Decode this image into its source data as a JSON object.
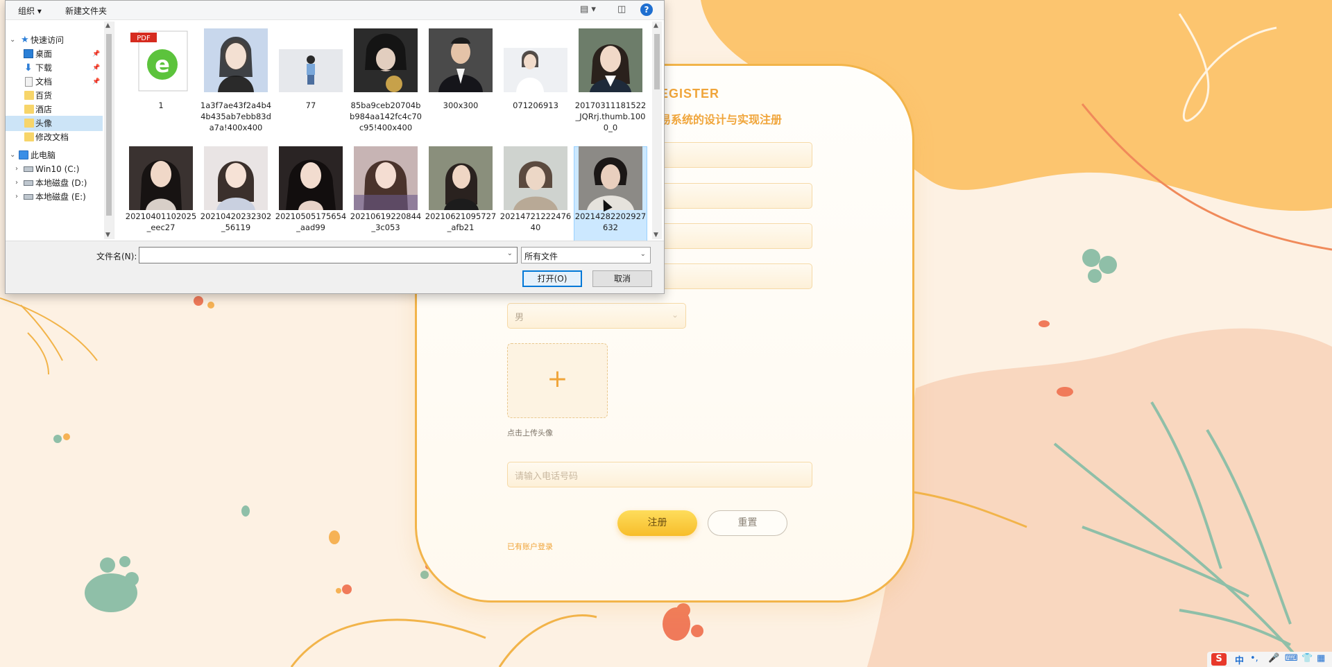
{
  "background": {
    "colors": {
      "base": "#fdf1e3",
      "orange_blob": "#fbc36c",
      "peach_blob": "#f6c6a8",
      "leaf": "#8fbfa8",
      "accent_red": "#f07a5a"
    }
  },
  "register_card": {
    "title": "EGISTER",
    "subtitle": "易系统的设计与实现注册",
    "gender_value": "男",
    "upload_plus": "+",
    "upload_hint": "点击上传头像",
    "phone_placeholder": "请输入电话号码",
    "register_button": "注册",
    "reset_button": "重置",
    "login_link": "已有账户登录"
  },
  "file_dialog": {
    "toolbar": {
      "organize": "组织 ▾",
      "new_folder": "新建文件夹",
      "help": "?"
    },
    "nav": {
      "quick_access": "快速访问",
      "items": [
        "桌面",
        "下载",
        "文档",
        "百货",
        "酒店",
        "头像",
        "修改文档"
      ],
      "selected": "头像",
      "this_pc": "此电脑",
      "drives": [
        "Win10 (C:)",
        "本地磁盘 (D:)",
        "本地磁盘 (E:)"
      ]
    },
    "files_row1": [
      {
        "name": "1",
        "pdf_badge": "PDF"
      },
      {
        "name": "1a3f7ae43f2a4b44b435ab7ebb83da7a!400x400"
      },
      {
        "name": "77"
      },
      {
        "name": "85ba9ceb20704bb984aa142fc4c70c95!400x400"
      },
      {
        "name": "300x300"
      },
      {
        "name": "071206913"
      },
      {
        "name": "20170311181522_JQRrj.thumb.1000_0"
      }
    ],
    "files_row2": [
      {
        "name": "20210401102025_eec27"
      },
      {
        "name": "20210420232302_56119"
      },
      {
        "name": "20210505175654_aad99"
      },
      {
        "name": "20210619220844_3c053"
      },
      {
        "name": "20210621095727_afb21"
      },
      {
        "name": "20214721222476​40"
      },
      {
        "name": "20214282202927632"
      }
    ],
    "filename_label": "文件名(N):",
    "filename_value": "",
    "filter_value": "所有文件",
    "open_button": "打开(O)",
    "cancel_button": "取消"
  },
  "tray": {
    "ime_logo": "S",
    "ime_mode": "中",
    "ime_punct": "•,",
    "mic": "🎤",
    "keyboard": "⌨",
    "skin": "👕",
    "grid": "▦"
  }
}
